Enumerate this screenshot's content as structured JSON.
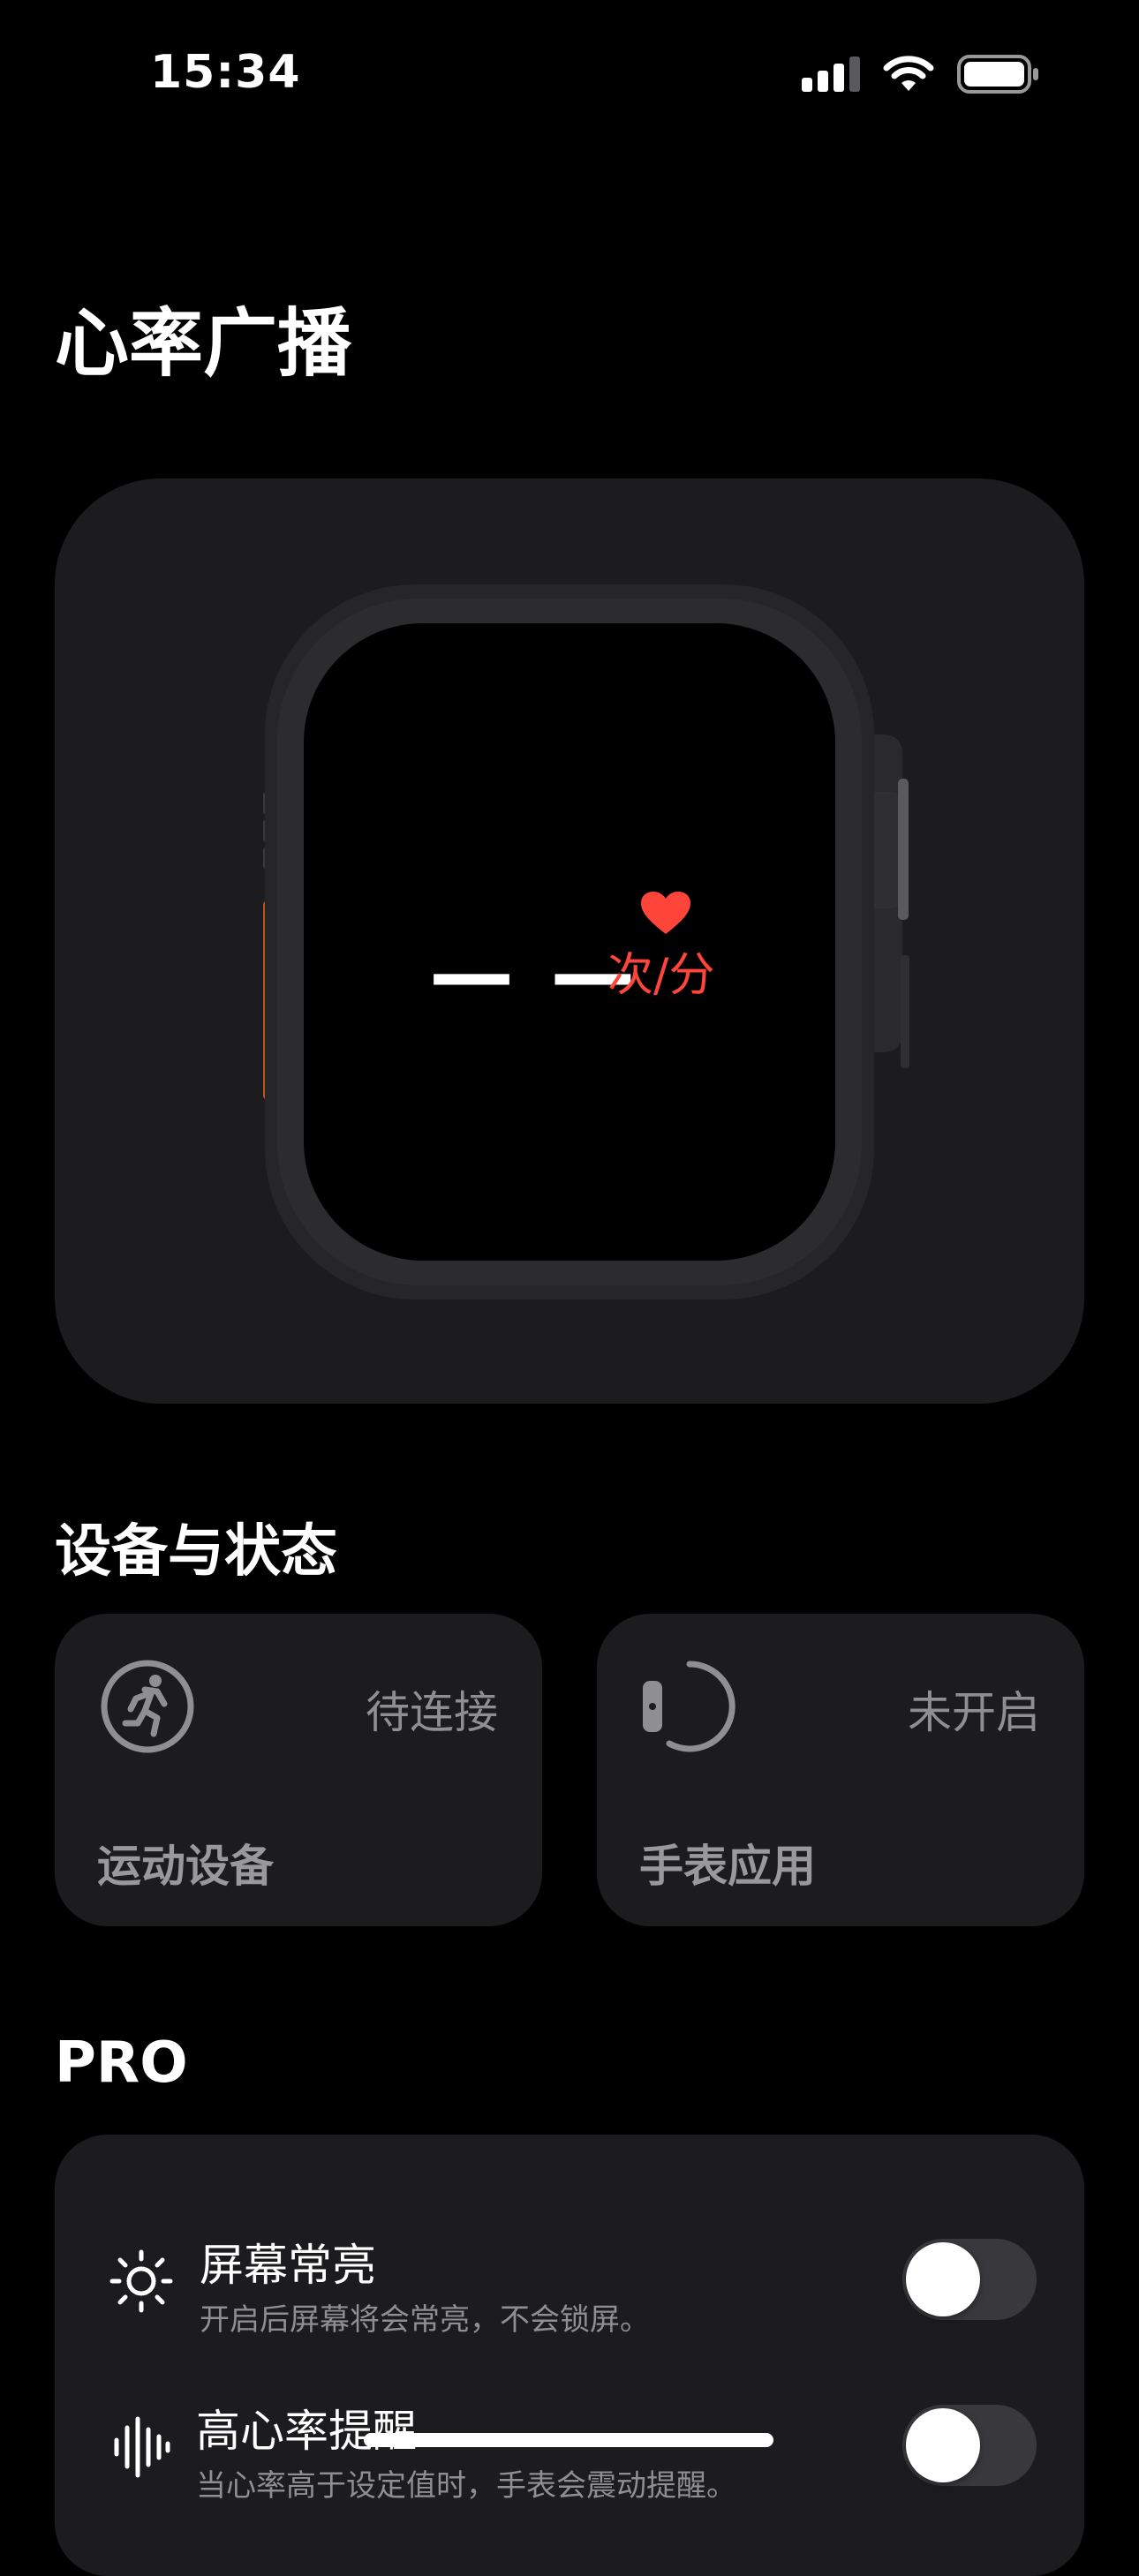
{
  "status_bar": {
    "time": "15:34"
  },
  "page": {
    "title": "心率广播"
  },
  "hero": {
    "bpm_placeholder": "— —",
    "bpm_unit": "次/分",
    "heart_color": "#ff453a"
  },
  "devices": {
    "section_title": "设备与状态",
    "tiles": [
      {
        "label": "运动设备",
        "status": "待连接",
        "icon": "running-figure-icon"
      },
      {
        "label": "手表应用",
        "status": "未开启",
        "icon": "watch-icon"
      }
    ]
  },
  "pro": {
    "section_title": "PRO",
    "rows": [
      {
        "title": "屏幕常亮",
        "subtitle": "开启后屏幕将会常亮，不会锁屏。",
        "icon": "sun-icon",
        "enabled": false
      },
      {
        "title": "高心率提醒",
        "subtitle": "当心率高于设定值时，手表会震动提醒。",
        "icon": "waveform-icon",
        "enabled": false
      }
    ]
  },
  "colors": {
    "accent": "#ff453a",
    "card": "#1c1c1e",
    "background": "#000000"
  }
}
